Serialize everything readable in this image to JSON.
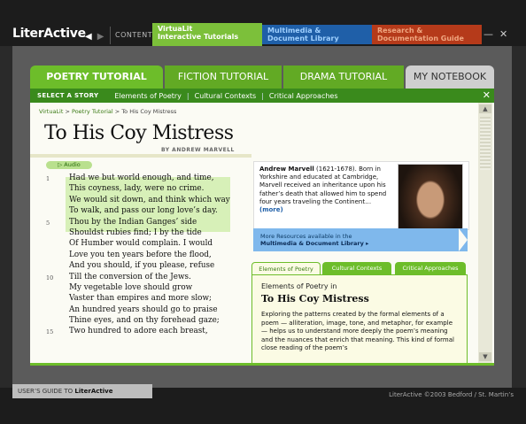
{
  "header": {
    "logo": "LiterActive",
    "back_icon": "left-arrow-icon",
    "forward_icon": "right-arrow-icon",
    "contents": "CONTENTS",
    "tab1_line1": "VirtuaLit",
    "tab1_line2": "Interactive Tutorials",
    "tab2_line1": "Multimedia &",
    "tab2_line2": "Document Library",
    "tab3_line1": "Research &",
    "tab3_line2": "Documentation Guide",
    "minimize": "—",
    "close": "✕"
  },
  "tabs": {
    "poetry": "POETRY TUTORIAL",
    "fiction": "FICTION TUTORIAL",
    "drama": "DRAMA TUTORIAL",
    "notebook": "MY NOTEBOOK"
  },
  "subnav": {
    "select": "SELECT A STORY",
    "link1": "Elements of Poetry",
    "link2": "Cultural Contexts",
    "link3": "Critical Approaches",
    "sep": "|",
    "close": "✕"
  },
  "breadcrumb": {
    "a": "VirtuaLit",
    "sep": " > ",
    "b": "Poetry Tutorial",
    "current": "To His Coy Mistress"
  },
  "poem": {
    "title": "To His Coy Mistress",
    "author": "BY ANDREW MARVELL",
    "audio": "▷ Audio",
    "lines": [
      {
        "num": "1",
        "text": "Had we but world enough, and time,"
      },
      {
        "num": "",
        "text": "This coyness, lady, were no crime."
      },
      {
        "num": "",
        "text": "We would sit down, and think which way"
      },
      {
        "num": "",
        "text": "To walk, and pass our long love’s day."
      },
      {
        "num": "5",
        "text": "Thou by the Indian Ganges’ side"
      },
      {
        "num": "",
        "text": "Shouldst rubies find; I by the tide"
      },
      {
        "num": "",
        "text": "Of Humber would complain. I would"
      },
      {
        "num": "",
        "text": "Love you ten years before the flood,"
      },
      {
        "num": "",
        "text": "And you should, if you please, refuse"
      },
      {
        "num": "10",
        "text": "Till the conversion of the Jews."
      },
      {
        "num": "",
        "text": "My vegetable love should grow"
      },
      {
        "num": "",
        "text": "Vaster than empires and more slow;"
      },
      {
        "num": "",
        "text": "An hundred years should go to praise"
      },
      {
        "num": "",
        "text": "Thine eyes, and on thy forehead gaze;"
      },
      {
        "num": "15",
        "text": "Two hundred to adore each breast,"
      }
    ]
  },
  "author_box": {
    "name": "Andrew Marvell",
    "bio": " (1621-1678). Born in Yorkshire and educated at Cambridge, Marvell received an inheritance upon his father’s death that allowed him to spend four years traveling the Continent…",
    "more": "(more)"
  },
  "resources": {
    "line1": "More Resources available in the",
    "line2": "Multimedia & Document Library ▸"
  },
  "element_tabs": {
    "e1": "Elements of Poetry",
    "e2": "Cultural Contexts",
    "e3": "Critical Approaches"
  },
  "elements": {
    "heading": "Elements of Poetry in",
    "title": "To His Coy Mistress",
    "body": "Exploring the patterns created by the formal elements of a poem — alliteration, image, tone, and metaphor, for example — helps us to understand more deeply the poem’s meaning and the nuances that enrich that meaning. This kind of formal close reading of the poem’s"
  },
  "scrollbar": {
    "up": "▲",
    "down": "▼"
  },
  "footer": {
    "guide_prefix": "USER’S GUIDE TO ",
    "guide_brand": "LiterActive",
    "copyright": "LiterActive ©2003 Bedford / St. Martin’s"
  }
}
